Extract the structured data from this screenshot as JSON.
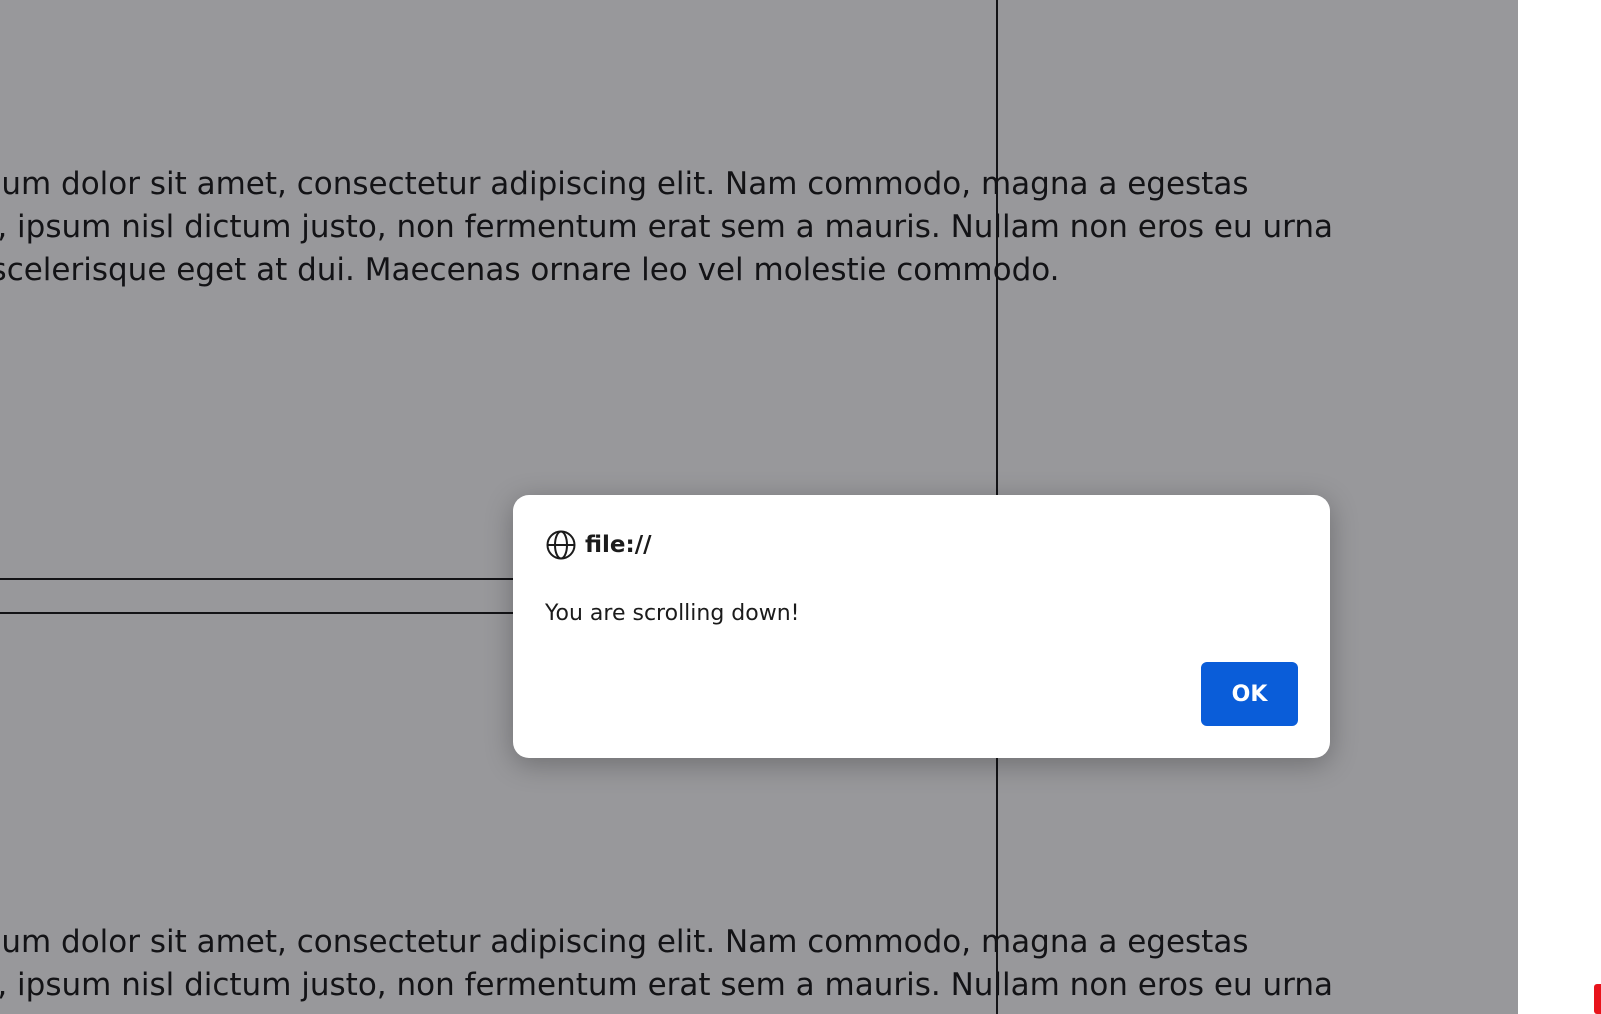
{
  "page": {
    "paragraph_1": {
      "line_1": "Lorem ipsum dolor sit amet, consectetur adipiscing elit. Nam commodo, magna a egestas",
      "line_2": "dignissim, ipsum nisl dictum justo, non fermentum erat sem a mauris. Nullam non eros eu urna",
      "line_3": "faucibus scelerisque eget at dui. Maecenas ornare leo vel molestie commodo."
    },
    "paragraph_2": {
      "line_1": "Lorem ipsum dolor sit amet, consectetur adipiscing elit. Nam commodo, magna a egestas",
      "line_2": "dignissim, ipsum nisl dictum justo, non fermentum erat sem a mauris. Nullam non eros eu urna"
    }
  },
  "dialog": {
    "origin": "file://",
    "message": "You are scrolling down!",
    "ok_label": "OK",
    "icon": "globe-icon"
  },
  "colors": {
    "ok_button": "#0a5dd9",
    "overlay": "rgba(40, 40, 45, 0.48)",
    "edge_marker": "#e8141c"
  }
}
